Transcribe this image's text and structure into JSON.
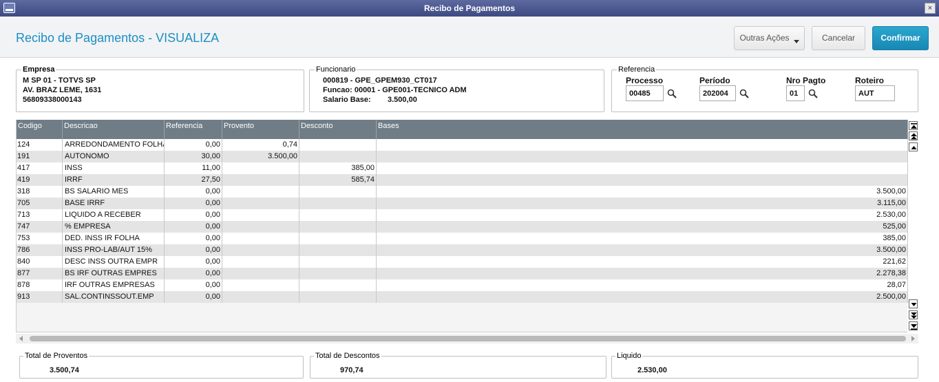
{
  "window": {
    "title": "Recibo de Pagamentos",
    "close_glyph": "×"
  },
  "header": {
    "title": "Recibo de Pagamentos - VISUALIZA"
  },
  "actions": {
    "outras": "Outras Ações",
    "cancel": "Cancelar",
    "confirm": "Confirmar"
  },
  "empresa": {
    "legend": "Empresa",
    "line1": "M SP 01  - TOTVS SP",
    "line2": "AV. BRAZ LEME, 1631",
    "line3": "56809338000143"
  },
  "funcionario": {
    "legend": "Funcionario",
    "line1": "000819 - GPE_GPEM930_CT017",
    "line2": "Funcao: 00001 - GPE001-TECNICO ADM",
    "salario_label": "Salario Base:",
    "salario_value": "3.500,00"
  },
  "referencia": {
    "legend": "Referencia",
    "processo_label": "Processo",
    "processo_value": "00485",
    "periodo_label": "Período",
    "periodo_value": "202004",
    "nropagto_label": "Nro Pagto",
    "nropagto_value": "01",
    "roteiro_label": "Roteiro",
    "roteiro_value": "AUT"
  },
  "grid": {
    "columns": [
      "Codigo",
      "Descricao",
      "Referencia",
      "Provento",
      "Desconto",
      "Bases"
    ],
    "rows": [
      [
        "124",
        "ARREDONDAMENTO FOLHA",
        "0,00",
        "0,74",
        "",
        ""
      ],
      [
        "191",
        "AUTONOMO",
        "30,00",
        "3.500,00",
        "",
        ""
      ],
      [
        "417",
        "INSS",
        "11,00",
        "",
        "385,00",
        ""
      ],
      [
        "419",
        "IRRF",
        "27,50",
        "",
        "585,74",
        ""
      ],
      [
        "318",
        "BS SALARIO MES",
        "0,00",
        "",
        "",
        "3.500,00"
      ],
      [
        "705",
        "BASE IRRF",
        "0,00",
        "",
        "",
        "3.115,00"
      ],
      [
        "713",
        "LIQUIDO A RECEBER",
        "0,00",
        "",
        "",
        "2.530,00"
      ],
      [
        "747",
        "% EMPRESA",
        "0,00",
        "",
        "",
        "525,00"
      ],
      [
        "753",
        "DED. INSS IR FOLHA",
        "0,00",
        "",
        "",
        "385,00"
      ],
      [
        "786",
        "INSS PRO-LAB/AUT 15%",
        "0,00",
        "",
        "",
        "3.500,00"
      ],
      [
        "840",
        "DESC INSS OUTRA EMPR",
        "0,00",
        "",
        "",
        "221,62"
      ],
      [
        "877",
        "BS IRF OUTRAS EMPRES",
        "0,00",
        "",
        "",
        "2.278,38"
      ],
      [
        "878",
        "IRF OUTRAS EMPRESAS",
        "0,00",
        "",
        "",
        "28,07"
      ],
      [
        "913",
        "SAL.CONTINSSOUT.EMP",
        "0,00",
        "",
        "",
        "2.500,00"
      ]
    ]
  },
  "totals": {
    "proventos_label": "Total de Proventos",
    "proventos_value": "3.500,74",
    "descontos_label": "Total de Descontos",
    "descontos_value": "970,74",
    "liquido_label": "Liquido",
    "liquido_value": "2.530,00"
  },
  "colors": {
    "accent": "#1b8fc4",
    "confirm": "#1e96c2",
    "titlebar": "#4a578f",
    "grid_header": "#707d86"
  }
}
